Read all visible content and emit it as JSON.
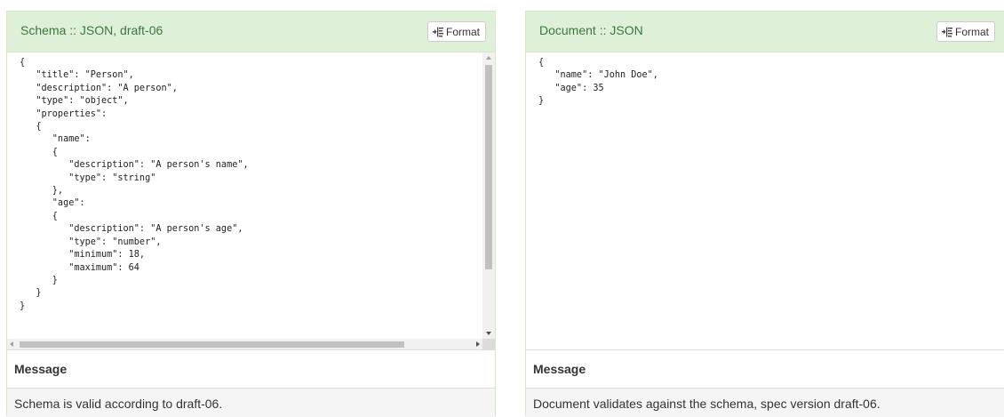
{
  "schema_panel": {
    "title": "Schema :: JSON, draft-06",
    "format_label": "Format",
    "code": "{\n   \"title\": \"Person\",\n   \"description\": \"A person\",\n   \"type\": \"object\",\n   \"properties\":\n   {\n      \"name\":\n      {\n         \"description\": \"A person's name\",\n         \"type\": \"string\"\n      },\n      \"age\":\n      {\n         \"description\": \"A person's age\",\n         \"type\": \"number\",\n         \"minimum\": 18,\n         \"maximum\": 64\n      }\n   }\n}",
    "message_label": "Message",
    "message_text": "Schema is valid according to draft-06."
  },
  "document_panel": {
    "title": "Document :: JSON",
    "format_label": "Format",
    "code": "{\n   \"name\": \"John Doe\",\n   \"age\": 35\n}",
    "message_label": "Message",
    "message_text": "Document validates against the schema, spec version draft-06."
  },
  "colors": {
    "heading_bg": "#dff0d8",
    "heading_text": "#3c763d",
    "message_bg": "#f5f5f5"
  },
  "icons": {
    "format": "format-indent-icon"
  }
}
